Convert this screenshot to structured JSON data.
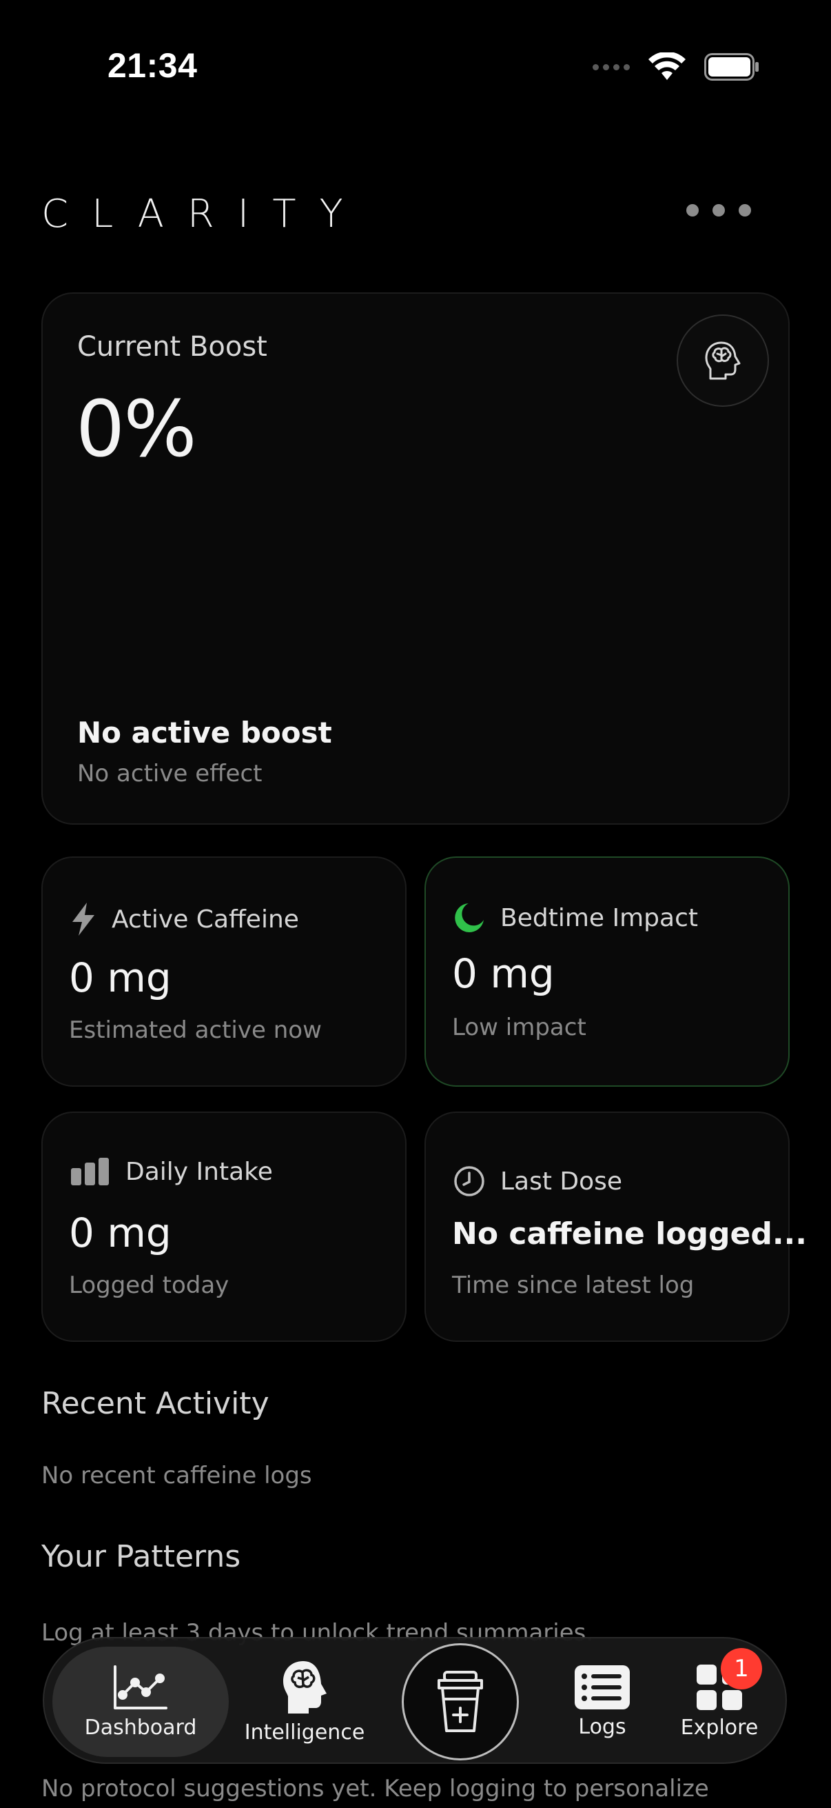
{
  "status_bar": {
    "time": "21:34"
  },
  "header": {
    "title": "CLARITY"
  },
  "boost_card": {
    "label": "Current Boost",
    "value": "0%",
    "status": "No active boost",
    "subtext": "No active effect"
  },
  "metrics": {
    "active_caffeine": {
      "title": "Active Caffeine",
      "value": "0 mg",
      "subtext": "Estimated active now",
      "icon": "lightning-icon"
    },
    "bedtime_impact": {
      "title": "Bedtime Impact",
      "value": "0 mg",
      "subtext": "Low impact",
      "icon": "moon-icon",
      "accent": "#30c04a"
    },
    "daily_intake": {
      "title": "Daily Intake",
      "value": "0 mg",
      "subtext": "Logged today",
      "icon": "bar-chart-icon"
    },
    "last_dose": {
      "title": "Last Dose",
      "value": "No caffeine logged...",
      "subtext": "Time since latest log",
      "icon": "clock-icon"
    }
  },
  "sections": {
    "recent_activity": {
      "title": "Recent Activity",
      "text": "No recent caffeine logs"
    },
    "patterns": {
      "title": "Your Patterns",
      "text": "Log at least 3 days to unlock trend summaries."
    },
    "protocols": {
      "text": "No protocol suggestions yet. Keep logging to personalize"
    }
  },
  "tabbar": {
    "dashboard": "Dashboard",
    "intelligence": "Intelligence",
    "logs": "Logs",
    "explore": "Explore",
    "explore_badge": "1"
  },
  "colors": {
    "background": "#000000",
    "card": "#090909",
    "badge": "#ff3b30",
    "moon": "#30c04a"
  }
}
